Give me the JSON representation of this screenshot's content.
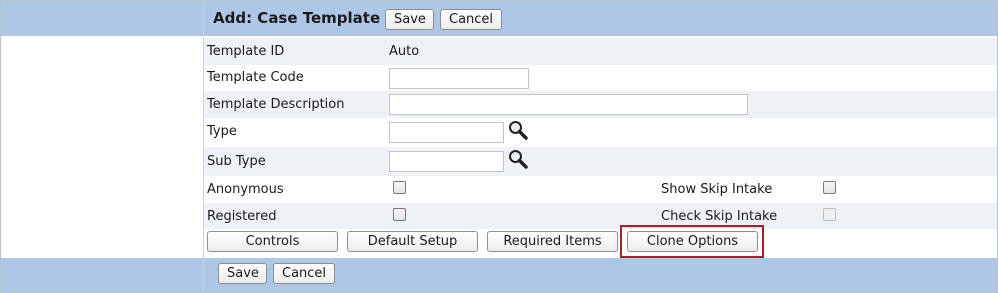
{
  "header": {
    "title": "Add: Case Template",
    "save_label": "Save",
    "cancel_label": "Cancel"
  },
  "form": {
    "template_id_label": "Template ID",
    "template_id_value": "Auto",
    "template_code_label": "Template Code",
    "template_code_value": "",
    "template_description_label": "Template Description",
    "template_description_value": "",
    "type_label": "Type",
    "type_value": "",
    "sub_type_label": "Sub Type",
    "sub_type_value": "",
    "anonymous_label": "Anonymous",
    "anonymous_checked": false,
    "show_skip_intake_label": "Show Skip Intake",
    "show_skip_intake_checked": false,
    "registered_label": "Registered",
    "registered_checked": false,
    "check_skip_intake_label": "Check Skip Intake",
    "check_skip_intake_checked": false,
    "check_skip_intake_disabled": true
  },
  "tabs": {
    "controls": "Controls",
    "default_setup": "Default Setup",
    "required_items": "Required Items",
    "clone_options": "Clone Options"
  },
  "footer": {
    "save_label": "Save",
    "cancel_label": "Cancel"
  },
  "colors": {
    "band": "#adc8e6",
    "row_alt": "#eef1f5",
    "highlight": "#b11e22"
  },
  "icons": {
    "type_lookup": "magnifier-icon",
    "sub_type_lookup": "magnifier-icon"
  }
}
